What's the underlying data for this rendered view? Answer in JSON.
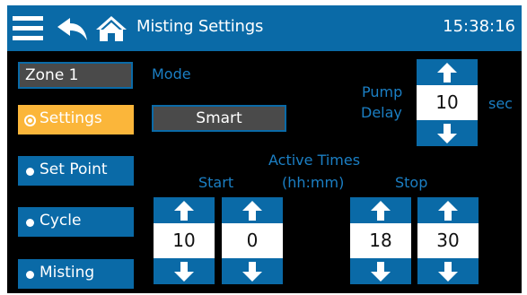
{
  "header": {
    "title": "Misting Settings",
    "time": "15:38:16",
    "icons": [
      "menu-icon",
      "back-icon",
      "home-icon"
    ]
  },
  "zone": {
    "label": "Zone 1"
  },
  "nav": {
    "settings": "Settings",
    "set_point": "Set Point",
    "cycle": "Cycle",
    "misting": "Misting"
  },
  "mode": {
    "label": "Mode",
    "value": "Smart"
  },
  "pump_delay": {
    "label_line1": "Pump",
    "label_line2": "Delay",
    "value": "10",
    "unit": "sec"
  },
  "active_times": {
    "title": "Active Times",
    "format": "(hh:mm)",
    "start_label": "Start",
    "stop_label": "Stop",
    "start_hours": "10",
    "start_minutes": "0",
    "stop_hours": "18",
    "stop_minutes": "30"
  },
  "colors": {
    "accent_blue": "#0a6aa7",
    "label_blue": "#1b7fc4",
    "active_orange": "#fbb63a",
    "background": "#000000"
  }
}
